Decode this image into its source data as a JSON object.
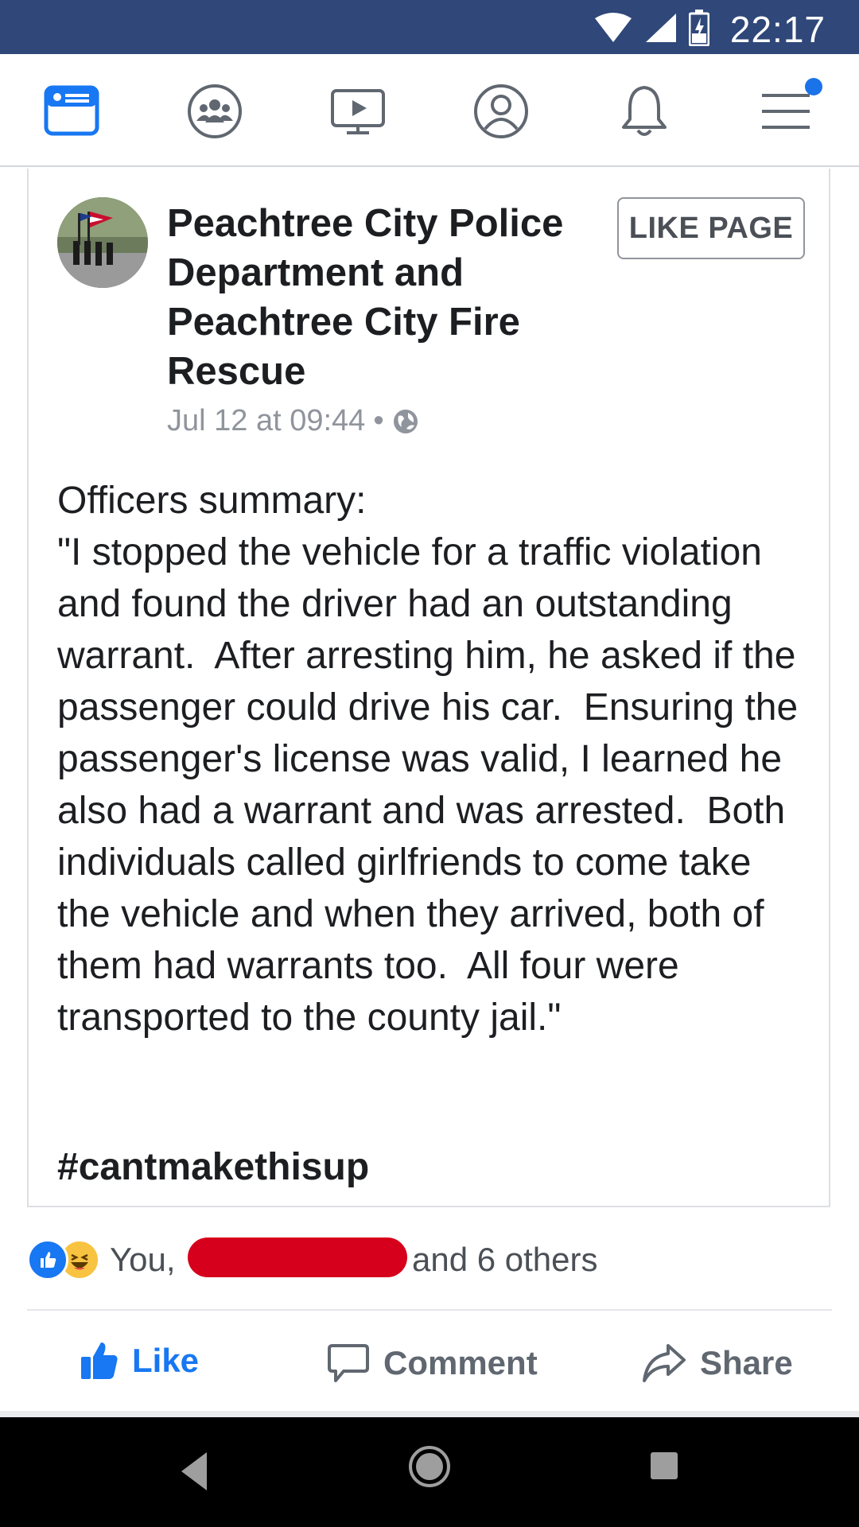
{
  "status_bar": {
    "time": "22:17"
  },
  "nav": {
    "items": [
      "news-feed",
      "groups",
      "watch",
      "profile",
      "notifications",
      "menu"
    ]
  },
  "post": {
    "page_name": "Peachtree City Police Department and Peachtree City Fire Rescue",
    "like_page_label": "LIKE PAGE",
    "timestamp": "Jul 12 at 09:44",
    "separator": "•",
    "privacy_icon": "globe-icon",
    "body": "Officers summary:\n\"I stopped the vehicle for a traffic violation and found the driver had an outstanding warrant.  After arresting him, he asked if the passenger could drive his car.  Ensuring the passenger's license was valid, I learned he also had a warrant and was arrested.  Both individuals called girlfriends to come take the vehicle and when they arrived, both of them had warrants too.  All four were transported to the county jail.\"",
    "hashtag": "#cantmakethisup"
  },
  "reactions": {
    "prefix": "You, ",
    "suffix": "and 6 others"
  },
  "actions": {
    "like": "Like",
    "comment": "Comment",
    "share": "Share"
  },
  "colors": {
    "status_bar": "#2f4779",
    "fb_blue": "#1877f2",
    "redaction": "#d6001c"
  }
}
